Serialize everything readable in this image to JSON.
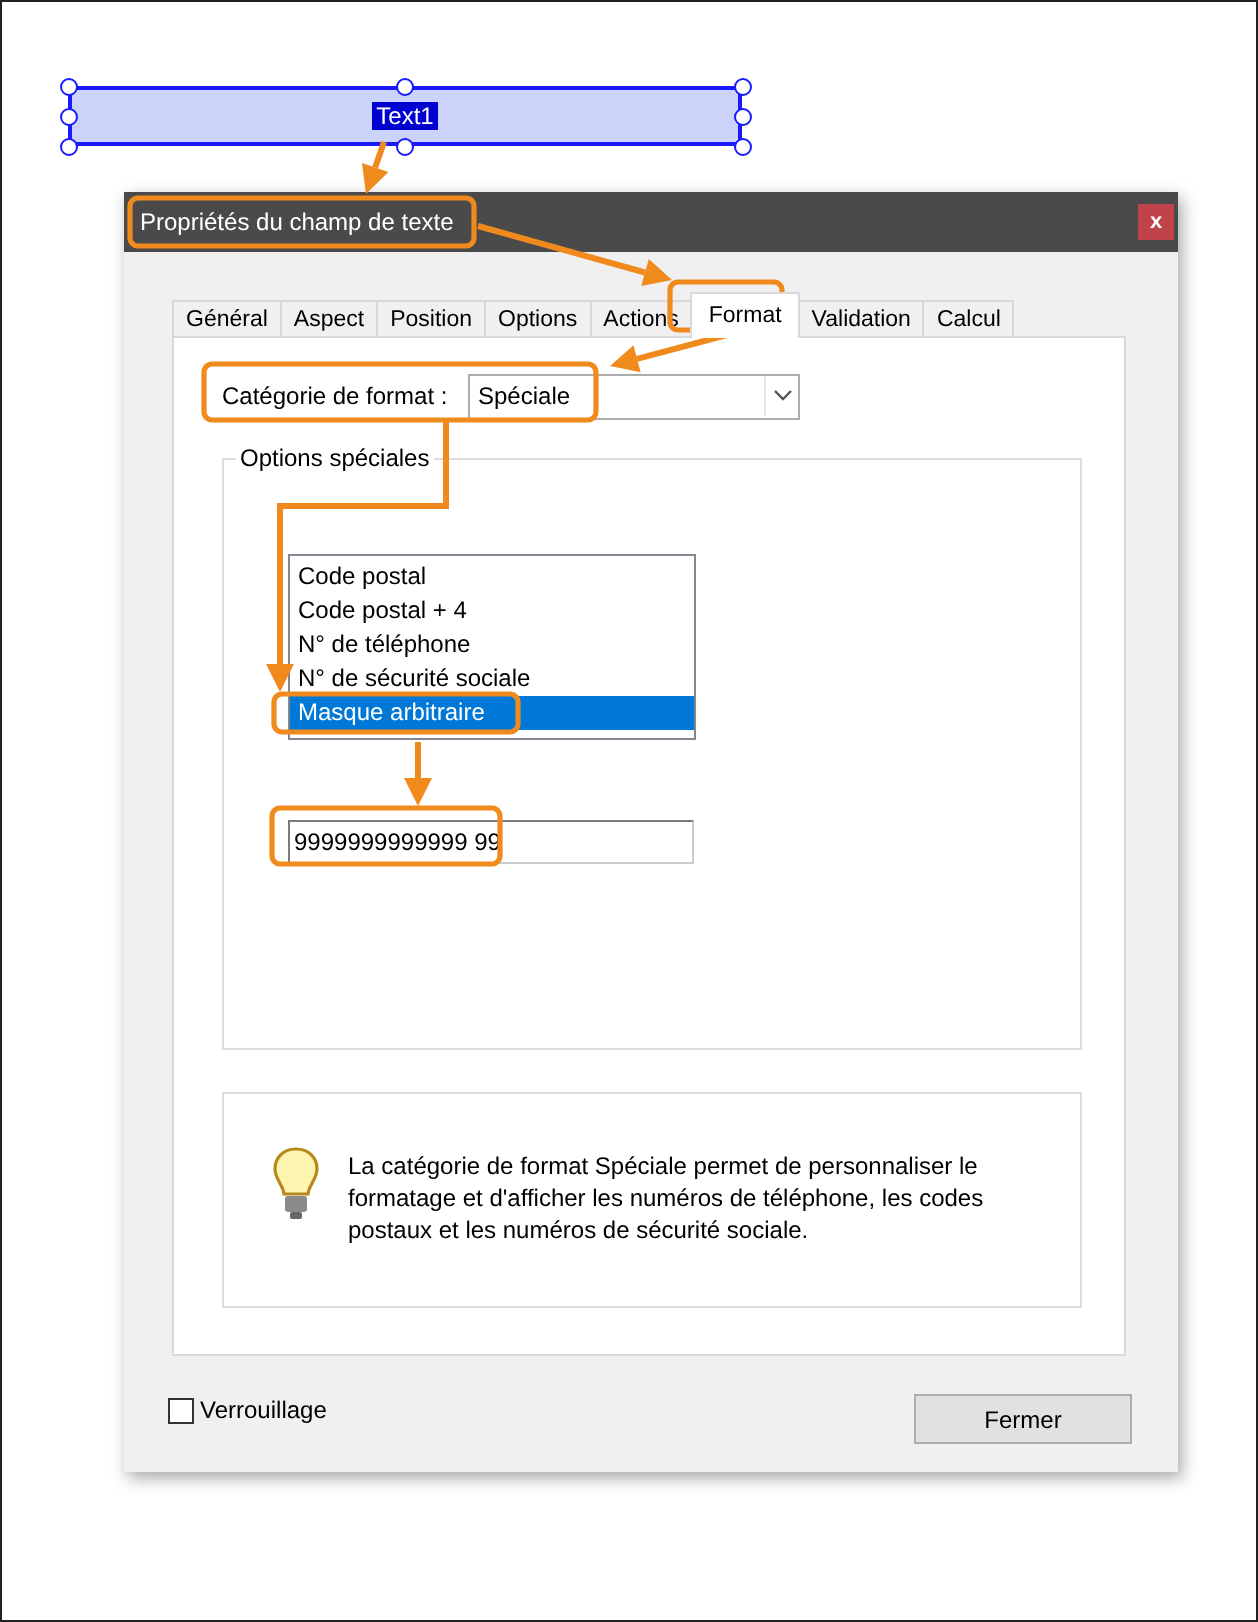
{
  "form_field": {
    "label": "Text1",
    "selected": true
  },
  "dialog": {
    "title": "Propriétés du champ de texte",
    "close": "x"
  },
  "tabs": [
    {
      "label": "Général",
      "selected": false
    },
    {
      "label": "Aspect",
      "selected": false
    },
    {
      "label": "Position",
      "selected": false
    },
    {
      "label": "Options",
      "selected": false
    },
    {
      "label": "Actions",
      "selected": false
    },
    {
      "label": "Format",
      "selected": true
    },
    {
      "label": "Validation",
      "selected": false
    },
    {
      "label": "Calcul",
      "selected": false
    }
  ],
  "format_category": {
    "label": "Catégorie de format :",
    "value": "Spéciale"
  },
  "special_options": {
    "title": "Options spéciales",
    "items": [
      {
        "label": "Code postal",
        "selected": false
      },
      {
        "label": "Code postal + 4",
        "selected": false
      },
      {
        "label": "N° de téléphone",
        "selected": false
      },
      {
        "label": "N° de sécurité sociale",
        "selected": false
      },
      {
        "label": "Masque arbitraire",
        "selected": true
      }
    ],
    "mask": "9999999999999 99"
  },
  "info": {
    "text": "La catégorie de format Spéciale permet de personnaliser le formatage et d'afficher les numéros de téléphone, les codes postaux et les numéros de sécurité sociale."
  },
  "lock": {
    "label": "Verrouillage",
    "checked": false
  },
  "close_button": "Fermer"
}
